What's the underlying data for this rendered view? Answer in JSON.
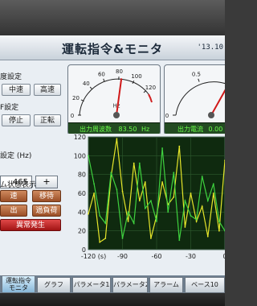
{
  "header": {
    "title": "運転指令&モニタ",
    "datetime": "'13.10"
  },
  "left_panel": {
    "speed_label": "度設定",
    "speed_buttons": [
      "中速",
      "高速"
    ],
    "run_label": "F設定",
    "run_buttons": [
      "停止",
      "正転"
    ],
    "freq_label": "設定 (Hz)",
    "freq_value": "465",
    "freq_plus": "+",
    "status_label": "ム状態表示",
    "status_buttons": [
      "速",
      "移待",
      "出",
      "過負荷"
    ],
    "alarm_button": "異常発生"
  },
  "gauges": [
    {
      "ticks": [
        "0",
        "20",
        "40",
        "60",
        "80",
        "100",
        "120"
      ],
      "unit": "Hz",
      "readout_label": "出力周波数",
      "readout_value": "83.50",
      "readout_unit": "Hz",
      "value": 83.5
    },
    {
      "ticks": [
        "0",
        "0.5",
        "1"
      ],
      "unit": "",
      "readout_label": "出力電流",
      "readout_value": "0.00",
      "readout_unit": "",
      "value": 0.85
    }
  ],
  "chart_data": {
    "type": "line",
    "x": [
      -120,
      -115,
      -110,
      -105,
      -100,
      -95,
      -90,
      -85,
      -80,
      -75,
      -70,
      -65,
      -60,
      -55,
      -50,
      -45,
      -40,
      -35,
      -30,
      -25,
      -20,
      -15,
      -10,
      -5,
      0
    ],
    "xticks": [
      "-120",
      "(s)",
      "-90",
      "-60",
      "-30",
      "0"
    ],
    "yticks": [
      "120",
      "100",
      "80",
      "60",
      "40",
      "20",
      "0"
    ],
    "ylim": [
      0,
      120
    ],
    "series": [
      {
        "color": "#e6e62a",
        "values": [
          38,
          60,
          8,
          12,
          78,
          118,
          62,
          30,
          92,
          52,
          72,
          12,
          36,
          72,
          48,
          56,
          110,
          24,
          60,
          30,
          46,
          14,
          60,
          20,
          95
        ]
      },
      {
        "color": "#3fd23f",
        "values": [
          100,
          70,
          36,
          28,
          82,
          64,
          12,
          40,
          28,
          92,
          44,
          52,
          30,
          108,
          40,
          82,
          10,
          52,
          36,
          32,
          78,
          52,
          70,
          30,
          20
        ]
      }
    ]
  },
  "tabs": [
    "運転指令\nモニタ",
    "グラフ",
    "パラメータ1",
    "パラメータ2",
    "アラーム",
    "ベース10"
  ]
}
